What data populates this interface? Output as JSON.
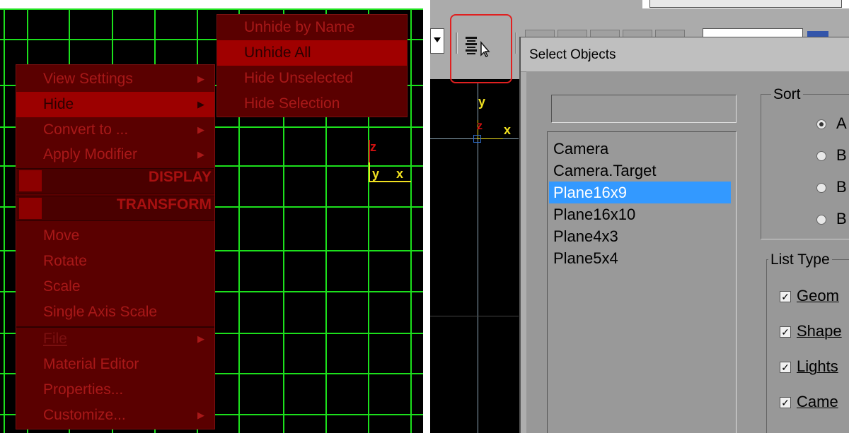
{
  "quad_menu": {
    "main_items": [
      {
        "label": "View Settings",
        "submenu": true
      },
      {
        "label": "Hide",
        "submenu": true,
        "selected": true
      },
      {
        "label": "Convert to ...",
        "submenu": true
      },
      {
        "label": "Apply Modifier",
        "submenu": true
      }
    ],
    "display_header": "DISPLAY",
    "transform_header": "TRANSFORM",
    "transform_items": [
      "Move",
      "Rotate",
      "Scale",
      "Single Axis Scale"
    ],
    "bottom_items": [
      {
        "label": "File",
        "submenu": true,
        "disabled": true
      },
      {
        "label": "Material Editor",
        "submenu": false
      },
      {
        "label": "Properties...",
        "submenu": false
      },
      {
        "label": "Customize...",
        "submenu": true
      }
    ],
    "hide_submenu": [
      {
        "label": "Unhide by Name"
      },
      {
        "label": "Unhide All",
        "selected": true
      },
      {
        "label": "Hide Unselected"
      },
      {
        "label": "Hide Selection"
      }
    ],
    "submenu_arrow": "▶"
  },
  "viewport_left": {
    "axis_labels": {
      "z": "z",
      "y": "y",
      "x": "x"
    }
  },
  "viewport_right": {
    "axis_labels": {
      "y": "y",
      "z": "z",
      "x": "x"
    }
  },
  "dialog": {
    "title": "Select Objects",
    "name_field_value": "",
    "objects": [
      "Camera",
      "Camera.Target",
      "Plane16x9",
      "Plane16x10",
      "Plane4x3",
      "Plane5x4"
    ],
    "selected_object": "Plane16x9",
    "sort_group": {
      "caption": "Sort",
      "options": [
        "A",
        "B",
        "B",
        "B"
      ],
      "selected_index": 0
    },
    "list_types": {
      "caption": "List Type",
      "items": [
        {
          "label": "Geom",
          "checked": true
        },
        {
          "label": "Shape",
          "checked": true
        },
        {
          "label": "Lights",
          "checked": true
        },
        {
          "label": "Came",
          "checked": true
        }
      ],
      "check_glyph": "✓"
    }
  },
  "toolbar": {
    "highlighted_button": "select-by-name-icon"
  },
  "colors": {
    "grid": "#1ce01c",
    "menu_bg": "#5a0000",
    "menu_text": "#a81818",
    "menu_highlight": "#9c0000",
    "list_selection": "#3399ff",
    "annotation_circle": "#e02020"
  }
}
